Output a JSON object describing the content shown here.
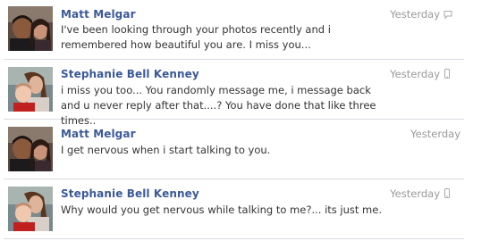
{
  "messages": [
    {
      "sender": "Matt Melgar",
      "text": "I've been looking through your photos recently and i remembered how beautiful you are. I miss you...",
      "time": "Yesterday",
      "source_icon": "chat-bubble-icon",
      "avatar": "avatar-matt"
    },
    {
      "sender": "Stephanie Bell Kenney",
      "text": "i miss you too... You randomly message me, i message back and u never reply after that....? You have done that like three times..",
      "time": "Yesterday",
      "source_icon": "mobile-phone-icon",
      "avatar": "avatar-stephanie"
    },
    {
      "sender": "Matt Melgar",
      "text": "I get nervous when i start talking to you.",
      "time": "Yesterday",
      "source_icon": "",
      "avatar": "avatar-matt"
    },
    {
      "sender": "Stephanie Bell Kenney",
      "text": "Why would you get nervous while talking to me?... its just me.",
      "time": "Yesterday",
      "source_icon": "mobile-phone-icon",
      "avatar": "avatar-stephanie"
    }
  ],
  "colors": {
    "sender_link": "#3b5998",
    "body_text": "#333333",
    "timestamp": "#999999",
    "divider": "#d8dbe2"
  }
}
